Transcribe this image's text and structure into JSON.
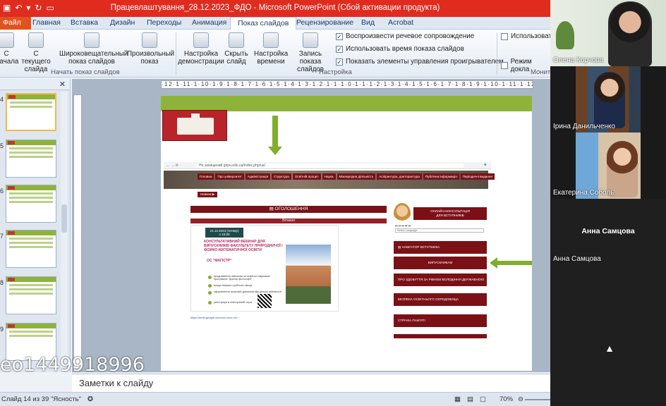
{
  "titlebar": {
    "title": "Працевлаштування_28.12.2023_ФДО  -  Microsoft PowerPoint (Сбой активации продукта)"
  },
  "ribbon_tabs": [
    "Главная",
    "Вставка",
    "Дизайн",
    "Переходы",
    "Анимация",
    "Показ слайдов",
    "Рецензирование",
    "Вид",
    "Acrobat"
  ],
  "file_tab": "Файл",
  "ribbon": {
    "btn_start": "С\nначала",
    "btn_current": "С текущего\nслайда",
    "btn_broadcast": "Широковещательный\nпоказ слайдов",
    "btn_custom": "Произвольный\nпоказ",
    "btn_setup": "Настройка\nдемонстрации",
    "btn_hide": "Скрыть\nслайд",
    "btn_timing": "Настройка\nвремени",
    "btn_record": "Запись показа\nслайдов",
    "chk_narration": "Воспроизвести речевое сопровождение",
    "chk_timings": "Использовать время показа слайдов",
    "chk_controls": "Показать элементы управления проигрывателем",
    "use_label": "Использоват",
    "presenter_label": "Режим докла",
    "group_start": "Начать показ слайдов",
    "group_setup": "Настройка",
    "group_monitors": "Монит"
  },
  "thumbnails": {
    "numbers": [
      "4",
      "5",
      "6",
      "7",
      "8",
      "9"
    ]
  },
  "ruler": "·12·1·11·1·10·1·9·1·8·1·7·1·6·1·5·1·4·1·3·1·2·1·1·1·0·1·1·1·2·1·3·1·4·1·5·1·6·1·7·1·8·1·9·1·10·1·11·1·12·",
  "slide": {
    "browser_tag": "Не захищений",
    "browser_url": "gnpu.edu.ua/index.php/ua/",
    "site_nav": [
      "Головна",
      "Про університет",
      "Адміністрація",
      "Структура",
      "Освітній процес",
      "Наука",
      "Міжнародна діяльність",
      "Аспірантура, докторантура",
      "Публічна інформація",
      "Періодичні видання"
    ],
    "news_btn": "Новини ▶",
    "news_header": "▤ ОГОЛОШЕННЯ",
    "news_sub": "Вітання",
    "webinar_date": "21.12.2023 (четвер)\nо 16:00",
    "webinar_title": "КОНСУЛЬТАТИВНИЙ ВЕБІНАР ДЛЯ ВИПУСКНИКІВ ФАКУЛЬТЕТУ ПРИРОДНИЧОЇ І ФІЗИКО-МАТЕМАТИЧНОЇ ОСВІТИ",
    "webinar_org": "ОС \"МАГІСТР\"",
    "webinar_points": [
      "продовження навчання за освітньо-науковою програмою \"Доктор філософії\"",
      "пошук першого робочого місця",
      "оформлення грошової допомоги від центру зайнятості",
      "реєстрація в електронній черзі"
    ],
    "webinar_link": "https://meet.google.com/xxx-xxxx-xxx",
    "consult_text": "ОНЛАЙН-КОНСУЛЬТАЦІЯ\nДЛЯ ВСТУПНИКІВ",
    "language_select": "Select Language",
    "right_menu": [
      "▤ НАВІГАТОР ВСТУПНИКА",
      "ВИПУСКНИКАМ",
      "ПРО ЗДОБУТТЯ ЗА РІВНЕМ ВОЛОДІННЯ ДЕРЖАВНОЮ МОВОЮ",
      "БЕЗПЕКА ОСВІТНЬОГО СЕРЕДОВИЩА",
      "СТРІЧКА ПАМ'ЯТІ"
    ]
  },
  "notes": {
    "placeholder": "Заметки к слайду"
  },
  "statusbar": {
    "slide_counter": "Слайд 14 из 39",
    "theme": "\"Ясность\"",
    "zoom": "70%"
  },
  "watermark": "eo1449918996",
  "participants": [
    {
      "name": "Олена Корчова"
    },
    {
      "name": "Ірина  Данильченко"
    },
    {
      "name": "Екатерина Соболь"
    },
    {
      "name": "Анна Самцова",
      "center_name": "Анна Самцова"
    }
  ],
  "colors": {
    "titlebar": "#e02b1f",
    "slide_bar": "#8fb33a",
    "site_maroon": "#7a1117",
    "arrow": "#7fae2c"
  }
}
